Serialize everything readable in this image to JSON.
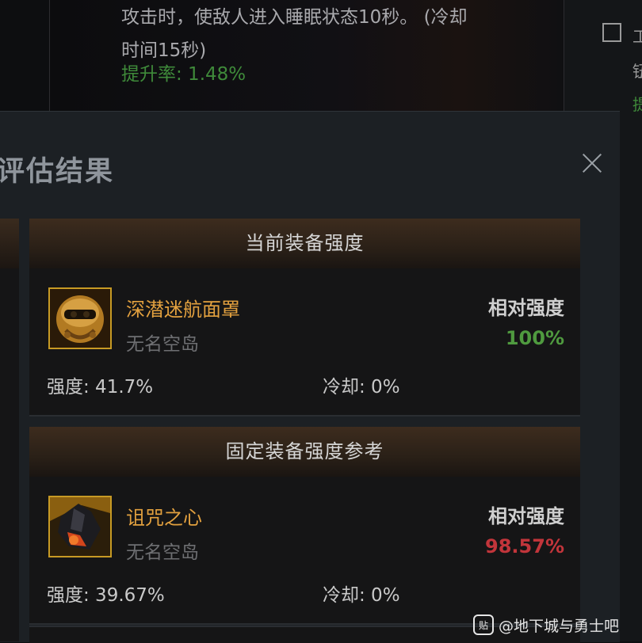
{
  "background_tooltip": {
    "line1": "攻击时，使敌人进入睡眠状态10秒。 (冷却",
    "line2": "时间15秒)",
    "rate": "提升率: 1.48%"
  },
  "right_edge_glyphs": [
    "工",
    "钮",
    "提"
  ],
  "dialog": {
    "title": "评估结果",
    "close_icon": "close-icon"
  },
  "cards": [
    {
      "header": "当前装备强度",
      "item_name": "深潜迷航面罩",
      "item_sub": "无名空岛",
      "icon": "mask-icon",
      "relative_label": "相对强度",
      "relative_value": "100%",
      "relative_color": "#4f9a3f",
      "strength": "强度: 41.7%",
      "cooldown": "冷却: 0%"
    },
    {
      "header": "固定装备强度参考",
      "item_name": "诅咒之心",
      "item_sub": "无名空岛",
      "icon": "dark-crystal-icon",
      "relative_label": "相对强度",
      "relative_value": "98.57%",
      "relative_color": "#c2353b",
      "strength": "强度: 39.67%",
      "cooldown": "冷却: 0%"
    }
  ],
  "watermark": "@地下城与勇士吧",
  "watermark_logo": "贴"
}
